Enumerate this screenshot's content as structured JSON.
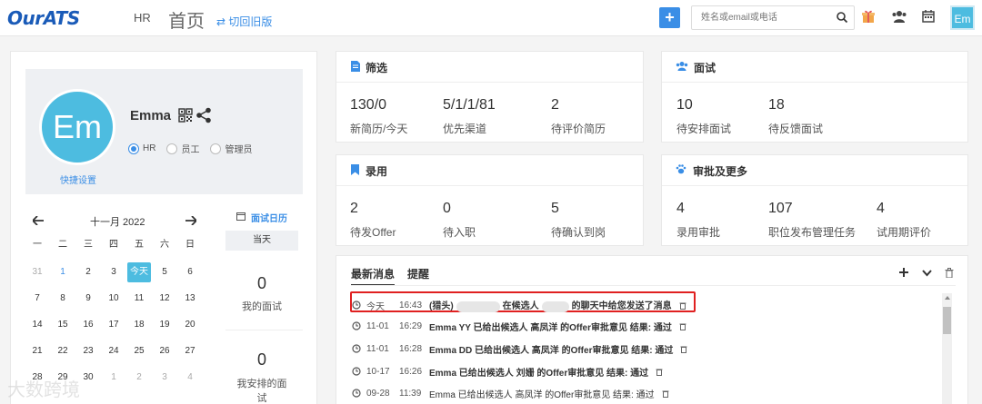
{
  "header": {
    "logo": "OurATS",
    "nav_hr": "HR",
    "nav_home": "首页",
    "switch_label": "⇄ 切回旧版",
    "add_label": "+",
    "search_placeholder": "姓名或email或电话",
    "avatar": "Em"
  },
  "profile": {
    "avatar": "Em",
    "name": "Emma",
    "roles": [
      "HR",
      "员工",
      "管理员"
    ],
    "selected_role": "HR",
    "quick_settings": "快捷设置"
  },
  "calendar": {
    "month_label": "十一月 2022",
    "weekdays": [
      "一",
      "二",
      "三",
      "四",
      "五",
      "六",
      "日"
    ],
    "weeks": [
      [
        "31",
        "1",
        "2",
        "3",
        "今天",
        "5",
        "6"
      ],
      [
        "7",
        "8",
        "9",
        "10",
        "11",
        "12",
        "13"
      ],
      [
        "14",
        "15",
        "16",
        "17",
        "18",
        "19",
        "20"
      ],
      [
        "21",
        "22",
        "23",
        "24",
        "25",
        "26",
        "27"
      ],
      [
        "28",
        "29",
        "30",
        "1",
        "2",
        "3",
        "4"
      ]
    ],
    "today_label": "今天"
  },
  "interview_side": {
    "calendar_link": "面试日历",
    "today_tab": "当天",
    "my_interviews_num": "0",
    "my_interviews_label": "我的面试",
    "arranged_num": "0",
    "arranged_label_1": "我安排的面",
    "arranged_label_2": "试"
  },
  "screening": {
    "title": "筛选",
    "stats": [
      {
        "num": "130/0",
        "label": "新简历/今天"
      },
      {
        "num": "5/1/1/81",
        "label": "优先渠道"
      },
      {
        "num": "2",
        "label": "待评价简历"
      }
    ]
  },
  "interview": {
    "title": "面试",
    "stats": [
      {
        "num": "10",
        "label": "待安排面试"
      },
      {
        "num": "18",
        "label": "待反馈面试"
      }
    ]
  },
  "hiring": {
    "title": "录用",
    "stats": [
      {
        "num": "2",
        "label": "待发Offer"
      },
      {
        "num": "0",
        "label": "待入职"
      },
      {
        "num": "5",
        "label": "待确认到岗"
      }
    ]
  },
  "approval": {
    "title": "审批及更多",
    "stats": [
      {
        "num": "4",
        "label": "录用审批"
      },
      {
        "num": "107",
        "label": "职位发布管理任务"
      },
      {
        "num": "4",
        "label": "试用期评价"
      }
    ]
  },
  "messages": {
    "tab_latest": "最新消息",
    "tab_remind": "提醒",
    "items": [
      {
        "date": "今天",
        "time": "16:43",
        "pre": "(猎头)",
        "mid": "在候选人",
        "post": "的聊天中给您发送了消息"
      },
      {
        "date": "11-01",
        "time": "16:29",
        "text": "Emma YY 已给出候选人 高凤洋 的Offer审批意见 结果: 通过"
      },
      {
        "date": "11-01",
        "time": "16:28",
        "text": "Emma DD 已给出候选人 高凤洋 的Offer审批意见 结果: 通过"
      },
      {
        "date": "10-17",
        "time": "16:26",
        "text": "Emma 已给出候选人 刘姗 的Offer审批意见 结果: 通过"
      },
      {
        "date": "09-28",
        "time": "11:39",
        "text": "Emma 已给出候选人 高凤洋 的Offer审批意见 结果: 通过"
      }
    ]
  },
  "watermark": "大数跨境",
  "colors": {
    "accent": "#3a8ee6",
    "avatar": "#4dbce0",
    "highlight": "#e02020"
  }
}
